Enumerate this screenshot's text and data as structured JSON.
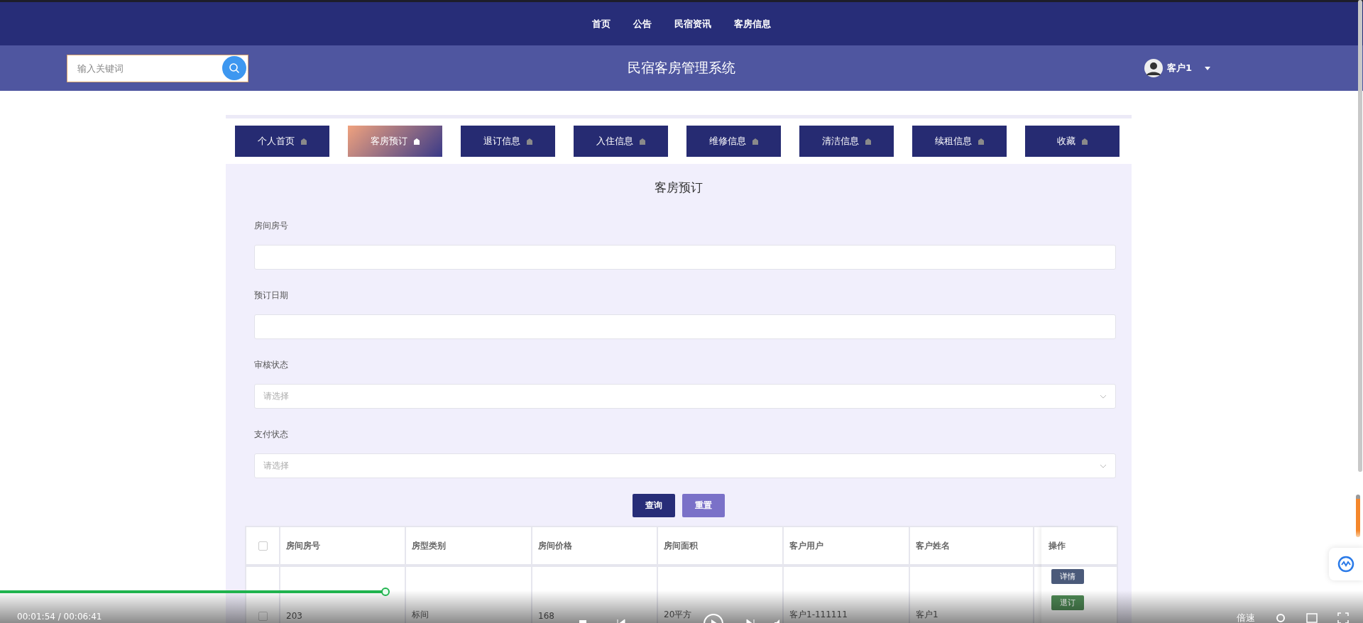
{
  "top_nav": {
    "items": [
      {
        "label": "首页"
      },
      {
        "label": "公告"
      },
      {
        "label": "民宿资讯"
      },
      {
        "label": "客房信息"
      }
    ]
  },
  "header": {
    "search": {
      "placeholder": "输入关键词"
    },
    "title": "民宿客房管理系统",
    "user": {
      "name": "客户1"
    }
  },
  "tabs": [
    {
      "label": "个人首页",
      "selected": false
    },
    {
      "label": "客房预订",
      "selected": true
    },
    {
      "label": "退订信息",
      "selected": false
    },
    {
      "label": "入住信息",
      "selected": false
    },
    {
      "label": "维修信息",
      "selected": false
    },
    {
      "label": "清洁信息",
      "selected": false
    },
    {
      "label": "续租信息",
      "selected": false
    },
    {
      "label": "收藏",
      "selected": false
    }
  ],
  "form": {
    "title": "客房预订",
    "fields": [
      {
        "kind": "text",
        "label": "房间房号"
      },
      {
        "kind": "text",
        "label": "预订日期"
      },
      {
        "kind": "select",
        "label": "审核状态",
        "placeholder": "请选择"
      },
      {
        "kind": "select",
        "label": "支付状态",
        "placeholder": "请选择"
      }
    ],
    "buttons": [
      {
        "kind": "primary",
        "label": "查询"
      },
      {
        "kind": "secondary",
        "label": "重置"
      }
    ]
  },
  "table": {
    "select_all": {
      "checked": false
    },
    "columns": [
      "房间房号",
      "房型类别",
      "房间价格",
      "房间面积",
      "客户用户",
      "客户姓名"
    ],
    "action_column": "操作",
    "rows": [
      {
        "checked": false,
        "cells": [
          "203",
          "标间",
          "168",
          "20平方",
          "客户1-111111",
          "客户1"
        ],
        "actions": [
          {
            "kind": "detail",
            "label": "详情"
          },
          {
            "kind": "cancel",
            "label": "退订"
          }
        ]
      }
    ]
  },
  "video_bar": {
    "level": 0.284,
    "time": "00:01:54 / 00:06:41",
    "speed": "倍速"
  }
}
